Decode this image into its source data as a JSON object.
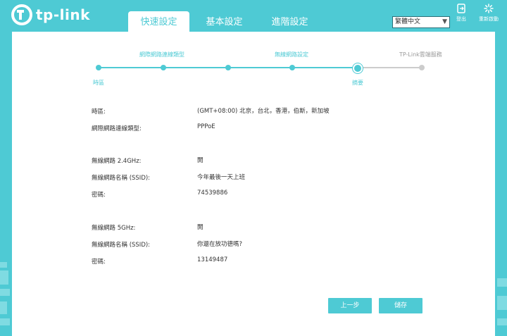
{
  "brand": {
    "logo_text": "tp-link"
  },
  "tabs": [
    {
      "label": "快速設定",
      "active": true
    },
    {
      "label": "基本設定",
      "active": false
    },
    {
      "label": "進階設定",
      "active": false
    }
  ],
  "language": {
    "selected": "繁體中文"
  },
  "top_actions": {
    "logout_label": "登出",
    "reboot_label": "重新啟動"
  },
  "steps": [
    {
      "label": "時區",
      "state": "done"
    },
    {
      "label": "網際網路連線類型",
      "state": "done"
    },
    {
      "label": "",
      "state": "done"
    },
    {
      "label": "無線網路設定",
      "state": "done"
    },
    {
      "label": "摘要",
      "state": "current"
    },
    {
      "label": "TP-Link雲端服務",
      "state": "pending"
    }
  ],
  "summary": {
    "timezone_label": "時區:",
    "timezone_value": "(GMT+08:00) 北京，台北，香港，伯斯，新加坡",
    "conn_type_label": "網際網路連線類型:",
    "conn_type_value": "PPPoE",
    "w24_label": "無線網路 2.4GHz:",
    "w24_value": "開",
    "w24_ssid_label": "無線網路名稱 (SSID):",
    "w24_ssid_value": "今年最後一天上班",
    "w24_pwd_label": "密碼:",
    "w24_pwd_value": "74539886",
    "w5_label": "無線網路 5GHz:",
    "w5_value": "開",
    "w5_ssid_label": "無線網路名稱 (SSID):",
    "w5_ssid_value": "你還在放功德嗎?",
    "w5_pwd_label": "密碼:",
    "w5_pwd_value": "13149487"
  },
  "buttons": {
    "back_label": "上一步",
    "save_label": "儲存"
  },
  "colors": {
    "accent": "#4ecad4",
    "pending": "#cccccc"
  }
}
